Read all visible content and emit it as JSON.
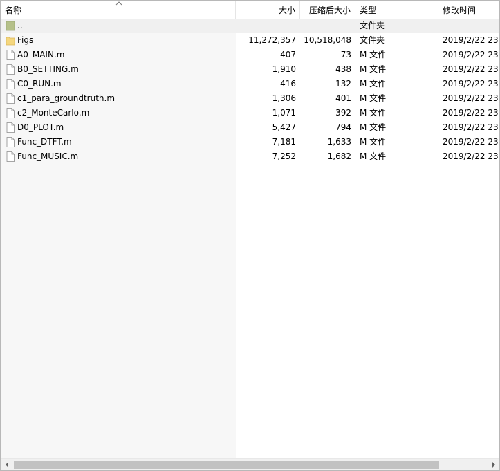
{
  "columns": {
    "name": "名称",
    "size": "大小",
    "packed": "压缩后大小",
    "type": "类型",
    "modified": "修改时间"
  },
  "parent": {
    "name": "..",
    "type": "文件夹"
  },
  "rows": [
    {
      "name": "Figs",
      "size": "11,272,357",
      "packed": "10,518,048",
      "type": "文件夹",
      "modified": "2019/2/22 23...",
      "icon": "folder-icon"
    },
    {
      "name": "A0_MAIN.m",
      "size": "407",
      "packed": "73",
      "type": "M 文件",
      "modified": "2019/2/22 23...",
      "icon": "file-icon"
    },
    {
      "name": "B0_SETTING.m",
      "size": "1,910",
      "packed": "438",
      "type": "M 文件",
      "modified": "2019/2/22 23...",
      "icon": "file-icon"
    },
    {
      "name": "C0_RUN.m",
      "size": "416",
      "packed": "132",
      "type": "M 文件",
      "modified": "2019/2/22 23...",
      "icon": "file-icon"
    },
    {
      "name": "c1_para_groundtruth.m",
      "size": "1,306",
      "packed": "401",
      "type": "M 文件",
      "modified": "2019/2/22 23...",
      "icon": "file-icon"
    },
    {
      "name": "c2_MonteCarlo.m",
      "size": "1,071",
      "packed": "392",
      "type": "M 文件",
      "modified": "2019/2/22 23...",
      "icon": "file-icon"
    },
    {
      "name": "D0_PLOT.m",
      "size": "5,427",
      "packed": "794",
      "type": "M 文件",
      "modified": "2019/2/22 23...",
      "icon": "file-icon"
    },
    {
      "name": "Func_DTFT.m",
      "size": "7,181",
      "packed": "1,633",
      "type": "M 文件",
      "modified": "2019/2/22 23...",
      "icon": "file-icon"
    },
    {
      "name": "Func_MUSIC.m",
      "size": "7,252",
      "packed": "1,682",
      "type": "M 文件",
      "modified": "2019/2/22 23...",
      "icon": "file-icon"
    }
  ],
  "colors": {
    "folder": "#f5d77e",
    "parent_folder": "#b5c089",
    "scroll_thumb": "#c2c2c2"
  }
}
